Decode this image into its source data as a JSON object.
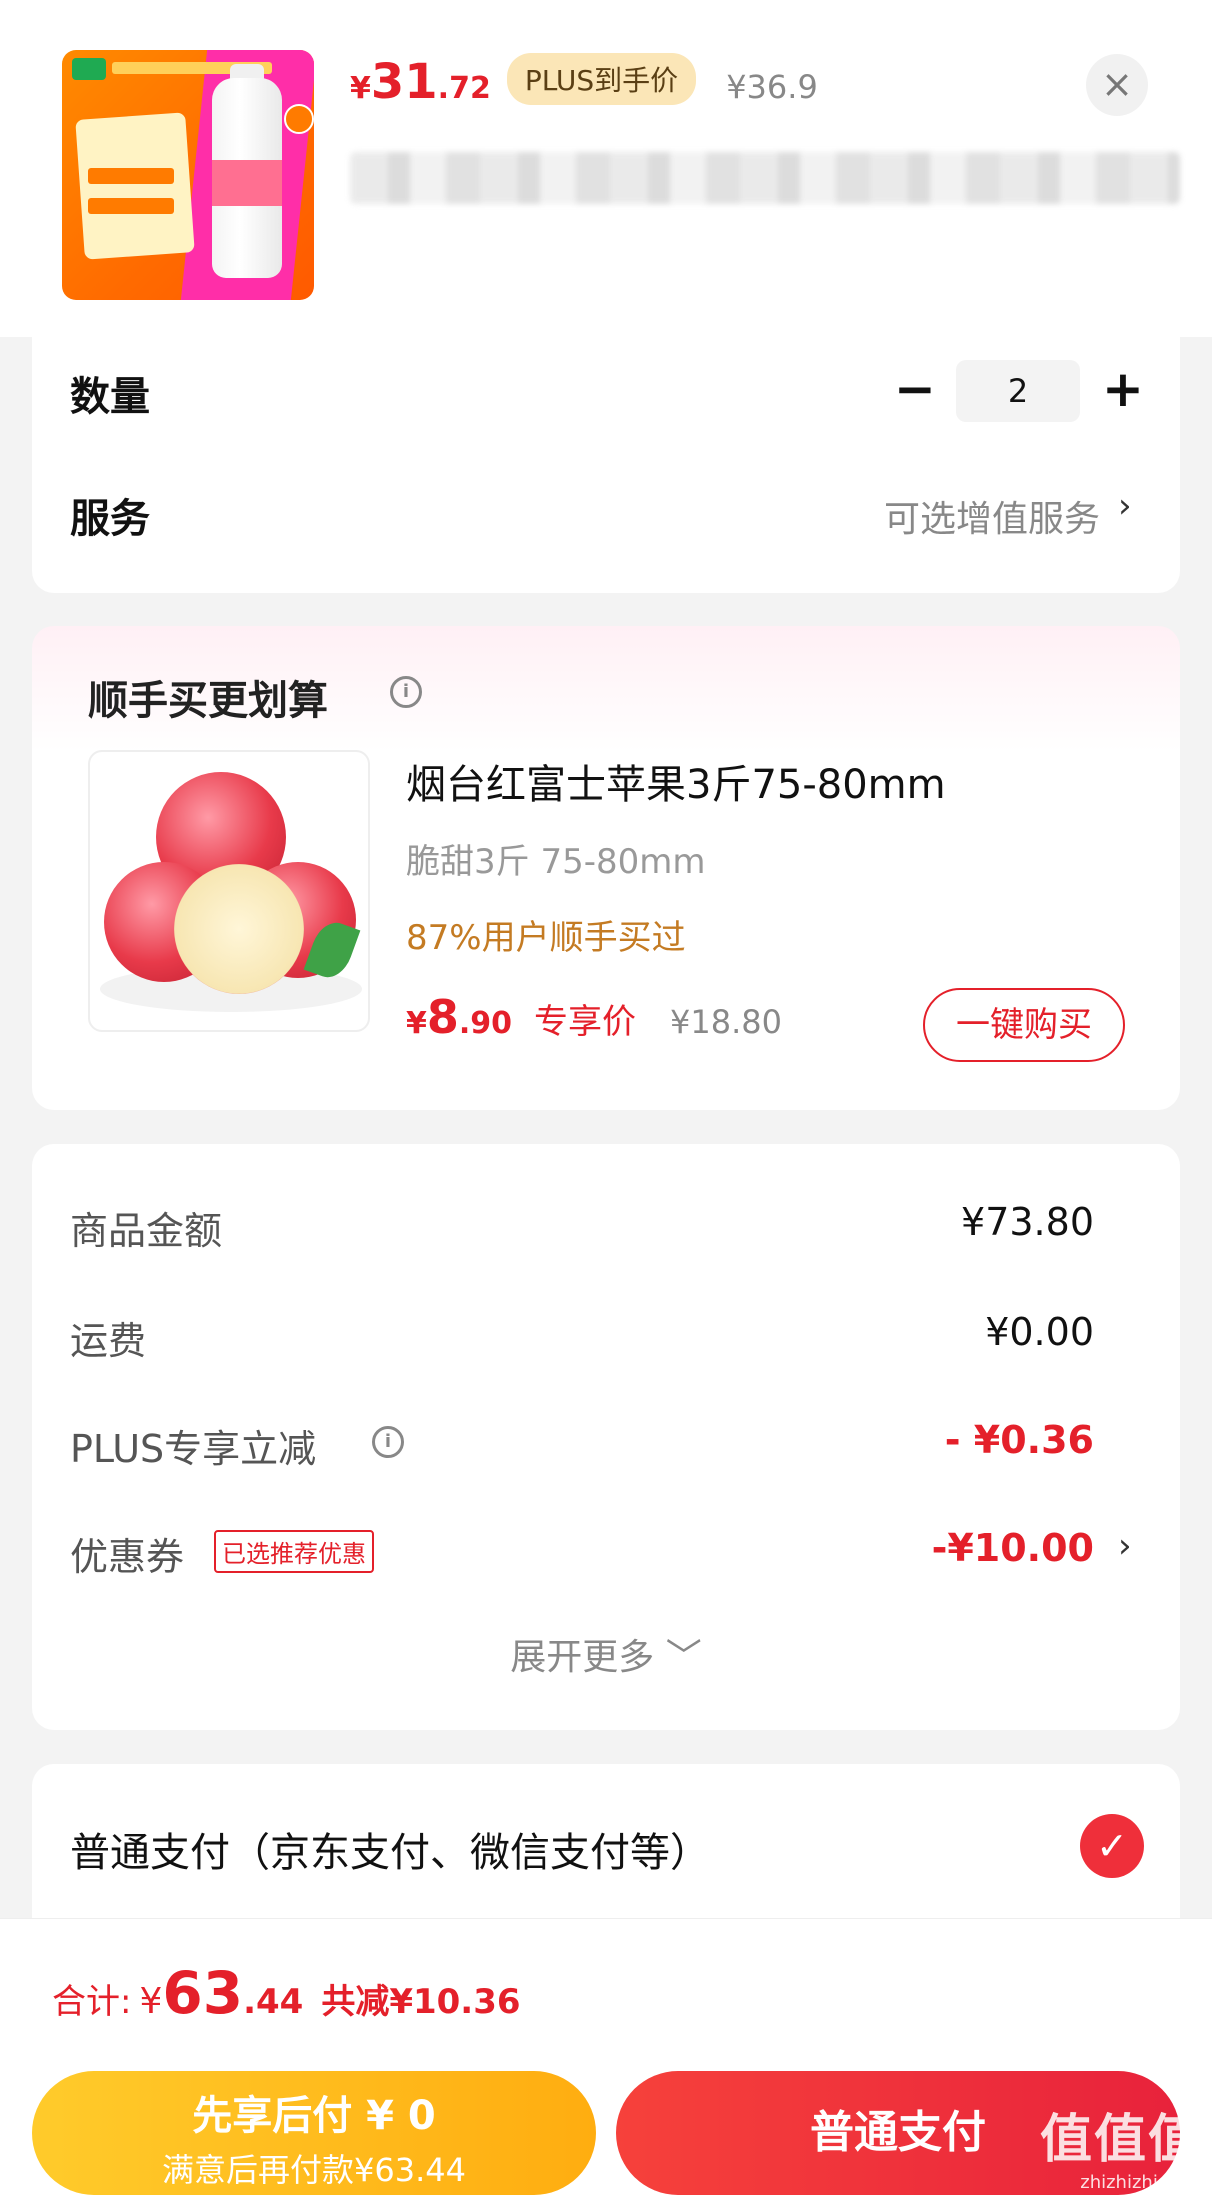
{
  "header": {
    "price_currency": "¥",
    "price_int": "31",
    "price_dec": ".72",
    "plus_tag": "PLUS到手价",
    "old_price": "¥36.9",
    "close_icon": "×"
  },
  "quantity": {
    "label": "数量",
    "value": "2",
    "minus": "−",
    "plus": "+"
  },
  "service": {
    "label": "服务",
    "value": "可选增值服务",
    "chevron": "›"
  },
  "bundle": {
    "title": "顺手买更划算",
    "info": "i",
    "product": {
      "name": "烟台红富士苹果3斤75-80mm",
      "spec": "脆甜3斤 75-80mm",
      "stat": "87%用户顺手买过",
      "price_currency": "¥",
      "price_int": "8",
      "price_dec": ".90",
      "price_tag": "专享价",
      "old_price": "¥18.80",
      "buy_label": "一键购买"
    }
  },
  "summary": {
    "rows": [
      {
        "label": "商品金额",
        "value": "¥73.80"
      },
      {
        "label": "运费",
        "value": "¥0.00"
      },
      {
        "label": "PLUS专享立减",
        "value": "- ¥0.36"
      },
      {
        "label": "优惠券",
        "value": "-¥10.00"
      }
    ],
    "coupon_tag": "已选推荐优惠",
    "info": "i",
    "chevron": "›",
    "expand": "展开更多 ﹀"
  },
  "payment": {
    "label": "普通支付（京东支付、微信支付等）",
    "check": "✓"
  },
  "bottom": {
    "total_label": "合计:",
    "total_currency": "¥",
    "total_int": "63",
    "total_dec": ".44",
    "saved": "共减¥10.36",
    "later_line1": "先享后付 ¥ 0",
    "later_line2": "满意后再付款¥63.44",
    "pay_button": "普通支付",
    "watermark": "值值值",
    "watermark_url": "zhizhizhi.com"
  },
  "colors": {
    "accent_red": "#e4202a",
    "plus_gold": "#fbe6b7",
    "later_yellow": "#ffb71a"
  }
}
